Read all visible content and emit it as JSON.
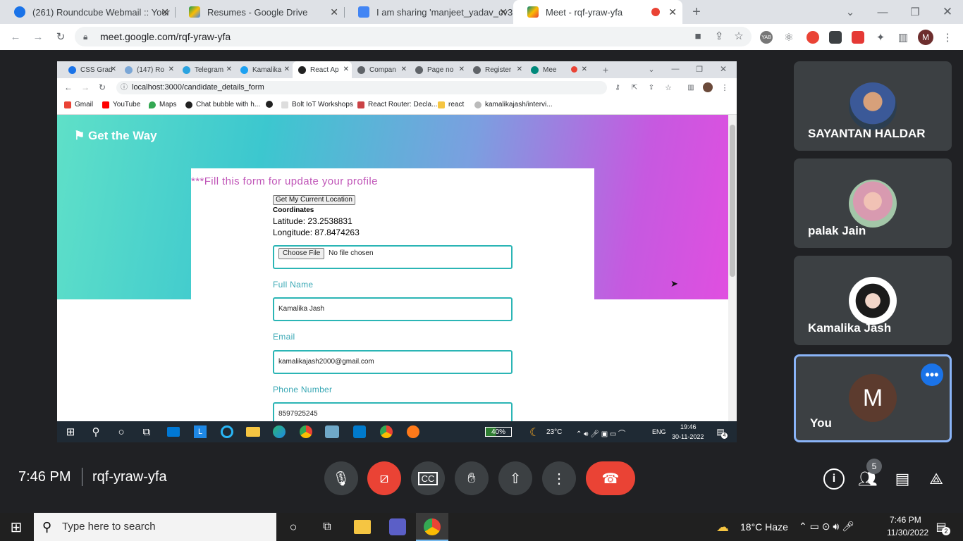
{
  "outer_tabs": [
    {
      "title": "(261) Roundcube Webmail :: Your",
      "icon": "roundcube-icon",
      "color": "#1a73e8"
    },
    {
      "title": "Resumes - Google Drive",
      "icon": "google-drive-icon",
      "color": "#fbbc04"
    },
    {
      "title": "I am sharing 'manjeet_yadav_cv3",
      "icon": "google-docs-icon",
      "color": "#4285f4"
    },
    {
      "title": "Meet - rqf-yraw-yfa",
      "icon": "google-meet-icon",
      "color": "#00897b"
    }
  ],
  "outer_url": "meet.google.com/rqf-yraw-yfa",
  "inner_tabs": [
    {
      "title": "CSS Grad"
    },
    {
      "title": "(147) Ro"
    },
    {
      "title": "Telegram"
    },
    {
      "title": "Kamalika"
    },
    {
      "title": "React Ap"
    },
    {
      "title": "Compan"
    },
    {
      "title": "Page no"
    },
    {
      "title": "Register"
    },
    {
      "title": "Mee"
    }
  ],
  "inner_url": "localhost:3000/candidate_details_form",
  "bookmarks": [
    "Gmail",
    "YouTube",
    "Maps",
    "Chat bubble with h...",
    "",
    "Bolt IoT Workshops",
    "React Router: Decla...",
    "react",
    "kamalikajash/intervi..."
  ],
  "page": {
    "brand": "Get the Way",
    "form_title": "***Fill this form for update your profile",
    "location_button": "Get My Current Location",
    "coordinates_label": "Coordinates",
    "latitude": "Latitude: 23.2538831",
    "longitude": "Longitude: 87.8474263",
    "file_button": "Choose File",
    "file_status": "No file chosen",
    "fields": [
      {
        "label": "Full Name",
        "value": "Kamalika Jash"
      },
      {
        "label": "Email",
        "value": "kamalikajash2000@gmail.com"
      },
      {
        "label": "Phone Number",
        "value": "8597925245"
      }
    ]
  },
  "shared_taskbar": {
    "battery": "40%",
    "temp": "23°C",
    "lang": "ENG",
    "time": "19:46",
    "date": "30-11-2022",
    "notif_count": "4"
  },
  "participants": [
    {
      "name": "SAYANTAN HALDAR",
      "avatar_color": "#6a7b8c"
    },
    {
      "name": "palak Jain",
      "avatar_color": "#c4a49a"
    },
    {
      "name": "Kamalika Jash",
      "avatar_color": "#e6e6e6"
    },
    {
      "name": "You",
      "initial": "M",
      "avatar_color": "#5c3b2e"
    }
  ],
  "meeting": {
    "time": "7:46 PM",
    "code": "rqf-yraw-yfa",
    "people_count": "5"
  },
  "windows_taskbar": {
    "search_placeholder": "Type here to search",
    "weather": "18°C Haze",
    "time": "7:46 PM",
    "date": "11/30/2022",
    "notif_count": "2"
  }
}
